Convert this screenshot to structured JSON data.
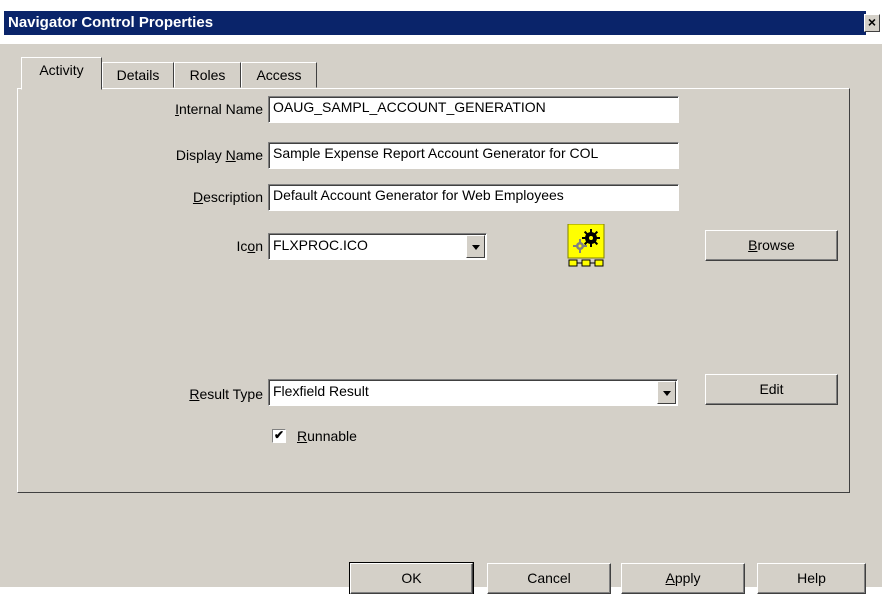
{
  "window": {
    "title": "Navigator Control Properties",
    "close": "×"
  },
  "tabs": [
    {
      "label": "Activity",
      "active": true
    },
    {
      "label": "Details"
    },
    {
      "label": "Roles"
    },
    {
      "label": "Access"
    }
  ],
  "form": {
    "internal_name": {
      "mnemonic": "I",
      "rest": "nternal Name",
      "value": "OAUG_SAMPL_ACCOUNT_GENERATION"
    },
    "display_name": {
      "pre": "Display ",
      "mnemonic": "N",
      "rest": "ame",
      "value": "Sample Expense Report Account Generator for COL"
    },
    "description": {
      "mnemonic": "D",
      "rest": "escription",
      "value": "Default Account Generator for Web Employees"
    },
    "icon": {
      "pre": "Ic",
      "mnemonic": "o",
      "rest": "n",
      "value": "FLXPROC.ICO",
      "preview_icon": "gears-icon"
    },
    "browse_button": {
      "mnemonic": "B",
      "rest": "rowse"
    },
    "result_type": {
      "mnemonic": "R",
      "rest": "esult Type",
      "value": "Flexfield Result"
    },
    "edit_button": {
      "label": "Edit"
    },
    "runnable": {
      "mnemonic": "R",
      "rest": "unnable",
      "checked": true,
      "mark": "✔"
    }
  },
  "buttons": {
    "ok": "OK",
    "cancel": "Cancel",
    "apply": {
      "mnemonic": "A",
      "rest": "pply"
    },
    "help": "Help"
  },
  "colors": {
    "title_bar": "#0a246a",
    "face": "#d4d0c8",
    "icon_bg": "#ffff00"
  }
}
